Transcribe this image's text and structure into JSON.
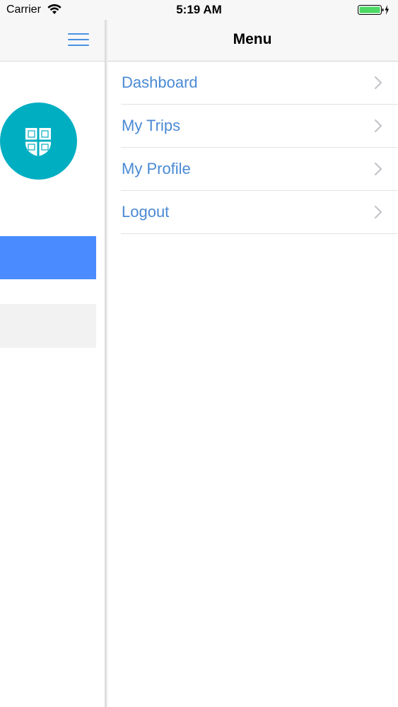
{
  "status_bar": {
    "carrier": "Carrier",
    "time": "5:19 AM",
    "wifi_icon": "wifi-icon",
    "battery_icon": "battery-charging-icon",
    "battery_color": "#4cd964"
  },
  "left_panel": {
    "menu_icon": "hamburger-menu-icon",
    "crest_icon": "shield-crest-icon",
    "crest_bg_color": "#00aec2",
    "button_color": "#4a8cff"
  },
  "menu": {
    "title": "Menu",
    "items": [
      {
        "label": "Dashboard"
      },
      {
        "label": "My Trips"
      },
      {
        "label": "My Profile"
      },
      {
        "label": "Logout"
      }
    ],
    "item_color": "#4a8ad4"
  }
}
